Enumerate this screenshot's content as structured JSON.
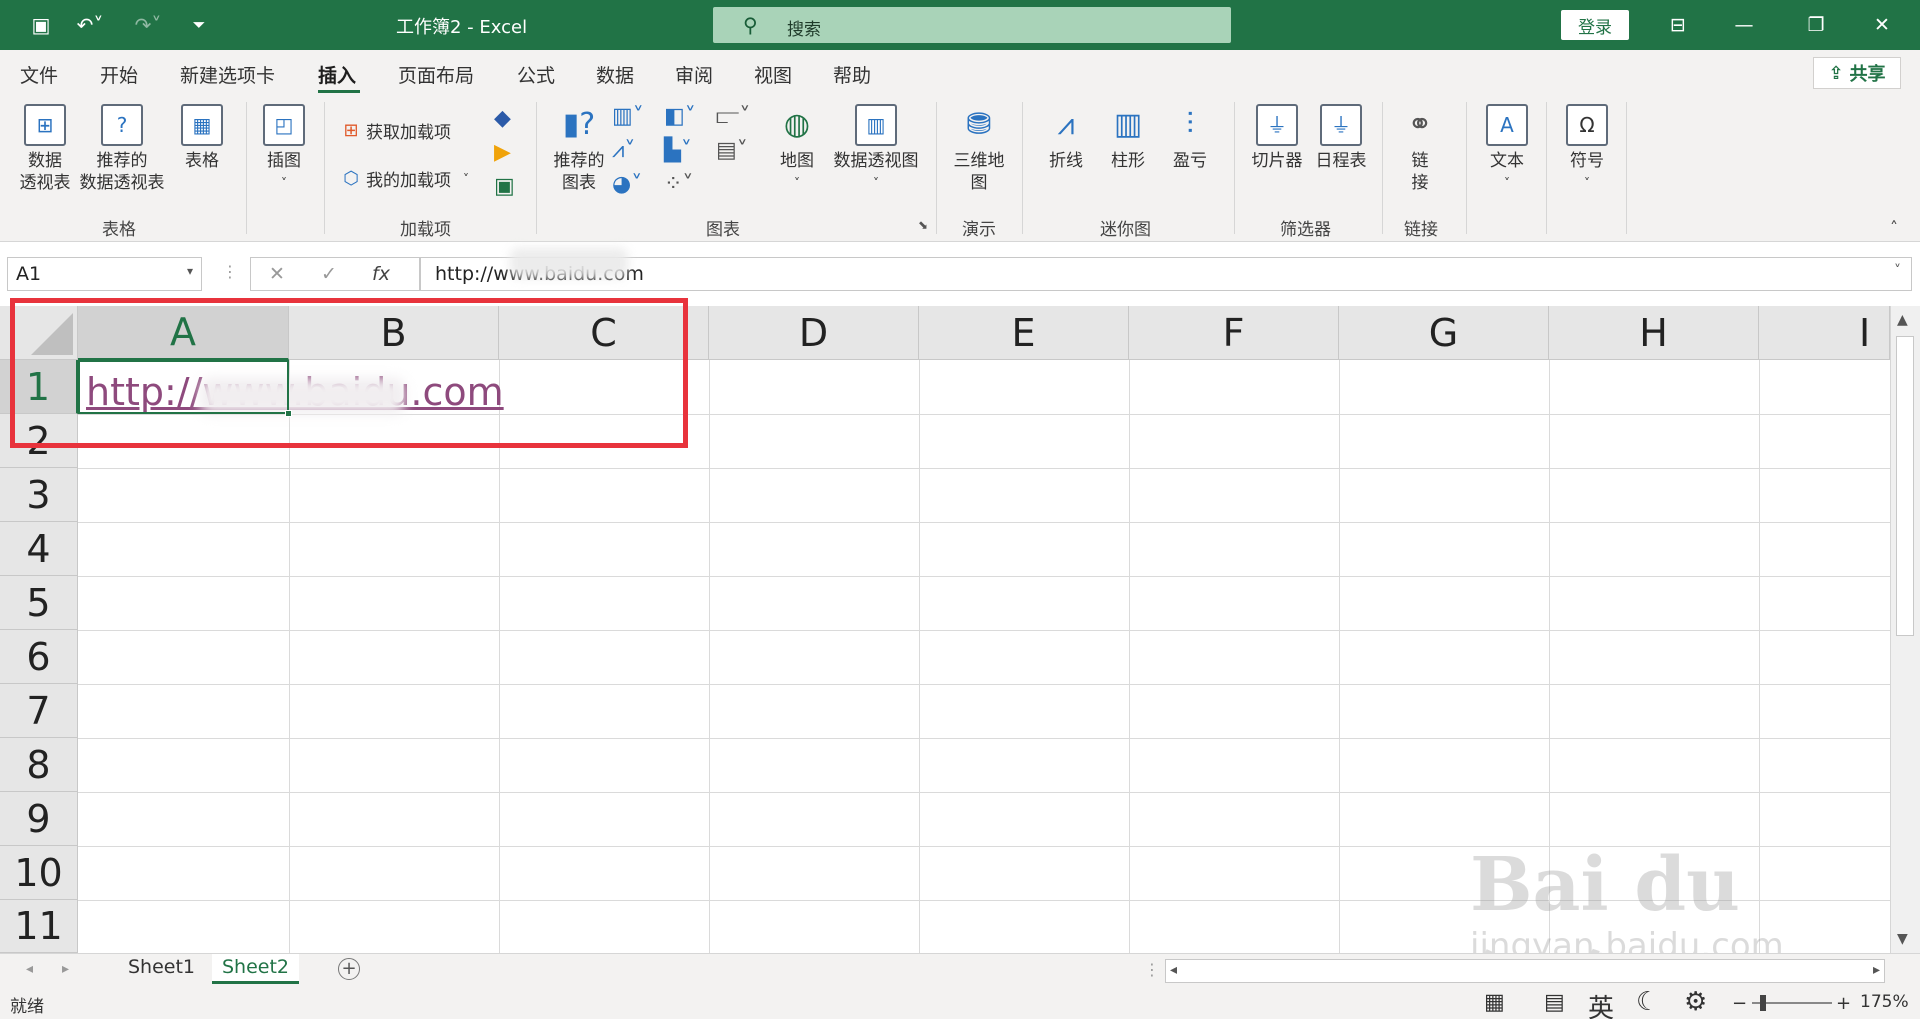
{
  "window": {
    "title": "工作簿2  -  Excel"
  },
  "search": {
    "placeholder": "搜索"
  },
  "account": {
    "login_label": "登录"
  },
  "menu": {
    "tabs": [
      "文件",
      "开始",
      "新建选项卡",
      "插入",
      "页面布局",
      "公式",
      "数据",
      "审阅",
      "视图",
      "帮助"
    ],
    "active": "插入",
    "share_label": "共享"
  },
  "ribbon": {
    "groups": [
      "表格",
      "加载项",
      "图表",
      "演示",
      "迷你图",
      "筛选器",
      "链接"
    ],
    "table": {
      "pivot": "数据\n透视表",
      "recommended_pivot": "推荐的\n数据透视表",
      "table": "表格"
    },
    "illustrations": {
      "label": "插图"
    },
    "addins": {
      "get": "获取加载项",
      "my": "我的加载项"
    },
    "charts": {
      "recommended": "推荐的\n图表",
      "map": "地图",
      "pivot_chart": "数据透视图"
    },
    "tours": {
      "map3d": "三维地\n图"
    },
    "sparklines": {
      "line": "折线",
      "column": "柱形",
      "winloss": "盈亏"
    },
    "filters": {
      "slicer": "切片器",
      "timeline": "日程表"
    },
    "links": {
      "link": "链\n接"
    },
    "text": {
      "label": "文本"
    },
    "symbols": {
      "label": "符号"
    }
  },
  "formula_bar": {
    "name_box": "A1",
    "formula": "http://www.baidu.com"
  },
  "sheet": {
    "columns": [
      "A",
      "B",
      "C",
      "D",
      "E",
      "F",
      "G",
      "H",
      "I"
    ],
    "rows": [
      "1",
      "2",
      "3",
      "4",
      "5",
      "6",
      "7",
      "8",
      "9",
      "10",
      "11"
    ],
    "a1_display": "http://www.baidu.com",
    "selected_cell": "A1"
  },
  "tabs": {
    "sheets": [
      "Sheet1",
      "Sheet2"
    ],
    "active": "Sheet2"
  },
  "status": {
    "text": "就绪",
    "ime": "英",
    "zoom": "175%"
  },
  "watermark": {
    "brand": "Bai du 经验",
    "url": "jingyan.baidu.com"
  },
  "colors": {
    "accent": "#217346",
    "link": "#8e4a7d",
    "highlight_box": "#e8333c"
  }
}
